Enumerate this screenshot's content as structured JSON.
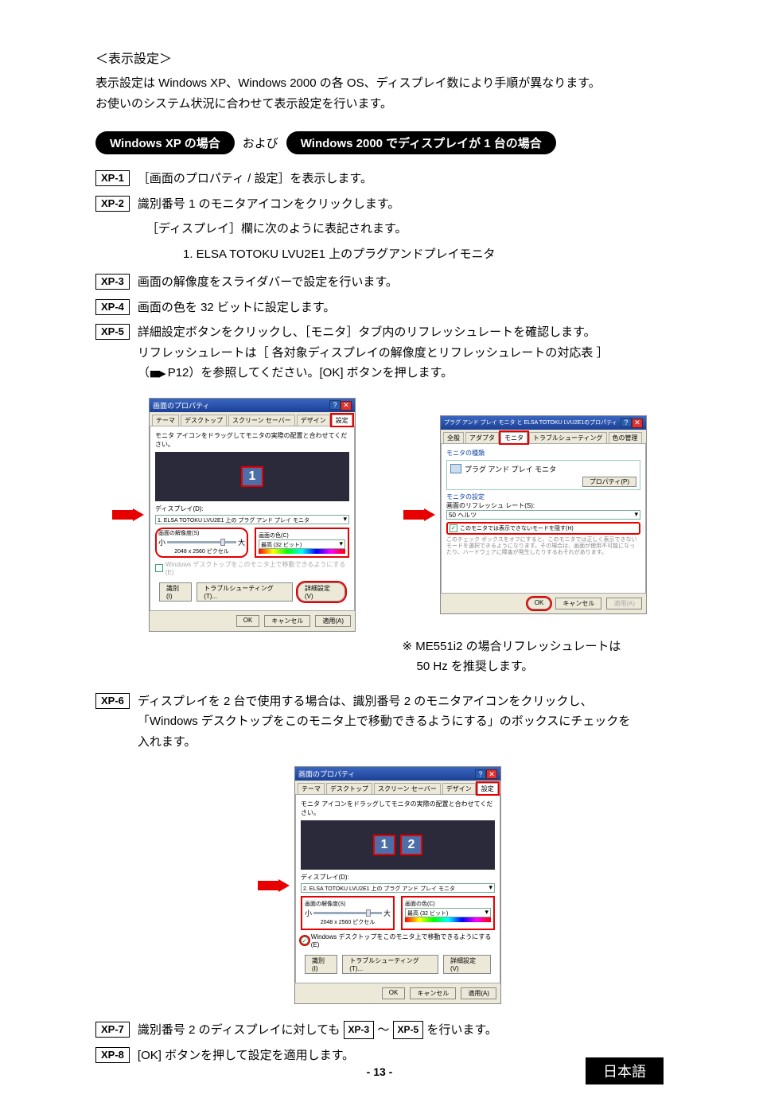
{
  "heading": "＜表示設定＞",
  "intro_line1": "表示設定は Windows XP、Windows 2000 の各 OS、ディスプレイ数により手順が異なります。",
  "intro_line2": "お使いのシステム状況に合わせて表示設定を行います。",
  "pill_xp": "Windows XP の場合",
  "pill_sep": "および",
  "pill_2000": "Windows 2000 でディスプレイが 1 台の場合",
  "steps": {
    "xp1_tag": "XP-1",
    "xp1": "［画面のプロパティ / 設定］を表示します。",
    "xp2_tag": "XP-2",
    "xp2": "識別番号 1 のモニタアイコンをクリックします。",
    "xp2_sub": "［ディスプレイ］欄に次のように表記されます。",
    "xp2_enum": "1. ELSA TOTOKU LVU2E1 上のプラグアンドプレイモニタ",
    "xp3_tag": "XP-3",
    "xp3": "画面の解像度をスライダバーで設定を行います。",
    "xp4_tag": "XP-4",
    "xp4": "画面の色を 32 ビットに設定します。",
    "xp5_tag": "XP-5",
    "xp5_l1": "詳細設定ボタンをクリックし、［モニタ］タブ内のリフレッシュレートを確認します。",
    "xp5_l2_a": "リフレッシュレートは［ 各対象ディスプレイの解像度とリフレッシュレートの対応表 ］",
    "xp5_l2_b": "（",
    "xp5_l2_c": " P12）を参照してください。[OK] ボタンを押します。",
    "xp6_tag": "XP-6",
    "xp6_l1": "ディスプレイを 2 台で使用する場合は、識別番号 2 のモニタアイコンをクリックし、",
    "xp6_l2": "「Windows デスクトップをこのモニタ上で移動できるようにする」のボックスにチェックを",
    "xp6_l3": "入れます。",
    "xp7_tag": "XP-7",
    "xp7_a": "識別番号 2 のディスプレイに対しても ",
    "xp7_ref1": "XP-3",
    "xp7_mid": " ～ ",
    "xp7_ref2": "XP-5",
    "xp7_b": " を行います。",
    "xp8_tag": "XP-8",
    "xp8": "[OK] ボタンを押して設定を適用します。"
  },
  "fig1": {
    "title": "画面のプロパティ",
    "tabs": [
      "テーマ",
      "デスクトップ",
      "スクリーン セーバー",
      "デザイン",
      "設定"
    ],
    "hint": "モニタ アイコンをドラッグしてモニタの実際の配置と合わせてください。",
    "display_label": "ディスプレイ(D):",
    "display_value": "1. ELSA TOTOKU LVU2E1 上の プラグ アンド プレイ モニタ",
    "res_label": "画面の解像度(S)",
    "res_low": "小",
    "res_high": "大",
    "res_value": "2048 x 2560 ピクセル",
    "color_label": "画面の色(C)",
    "color_value": "最高 (32 ビット)",
    "ext_label": "Windows デスクトップをこのモニタ上で移動できるようにする(E)",
    "btn_identify": "識別(I)",
    "btn_trouble": "トラブルシューティング(T)...",
    "btn_adv": "詳細設定(V)",
    "btn_ok": "OK",
    "btn_cancel": "キャンセル",
    "btn_apply": "適用(A)"
  },
  "fig2": {
    "title": "プラグ アンド プレイ モニタ と ELSA TOTOKU LVU2E1のプロパティ",
    "tabs": [
      "全般",
      "アダプタ",
      "モニタ",
      "トラブルシューティング",
      "色の管理"
    ],
    "grp1": "モニタの種類",
    "mon_name": "プラグ アンド プレイ モニタ",
    "btn_prop": "プロパティ(P)",
    "grp2": "モニタの設定",
    "refresh_label": "画面のリフレッシュ レート(S):",
    "refresh_value": "50 ヘルツ",
    "hide_label": "このモニタでは表示できないモードを隠す(H)",
    "note": "このチェック ボックスをオフにすると、このモニタでは正しく表示できないモードを選択できるようになります。その場合は、画面が使用不可能になったり、ハードウェアに障害が発生したりするおそれがあります。",
    "btn_ok": "OK",
    "btn_cancel": "キャンセル",
    "btn_apply": "適用(A)"
  },
  "caption_r1": "※ ME551i2 の場合リフレッシュレートは",
  "caption_r2": "50 Hz を推奨します。",
  "fig3": {
    "title": "画面のプロパティ",
    "display_value": "2. ELSA TOTOKU LVU2E1 上の プラグ アンド プレイ モニタ"
  },
  "page_num": "- 13 -",
  "lang": "日本語"
}
